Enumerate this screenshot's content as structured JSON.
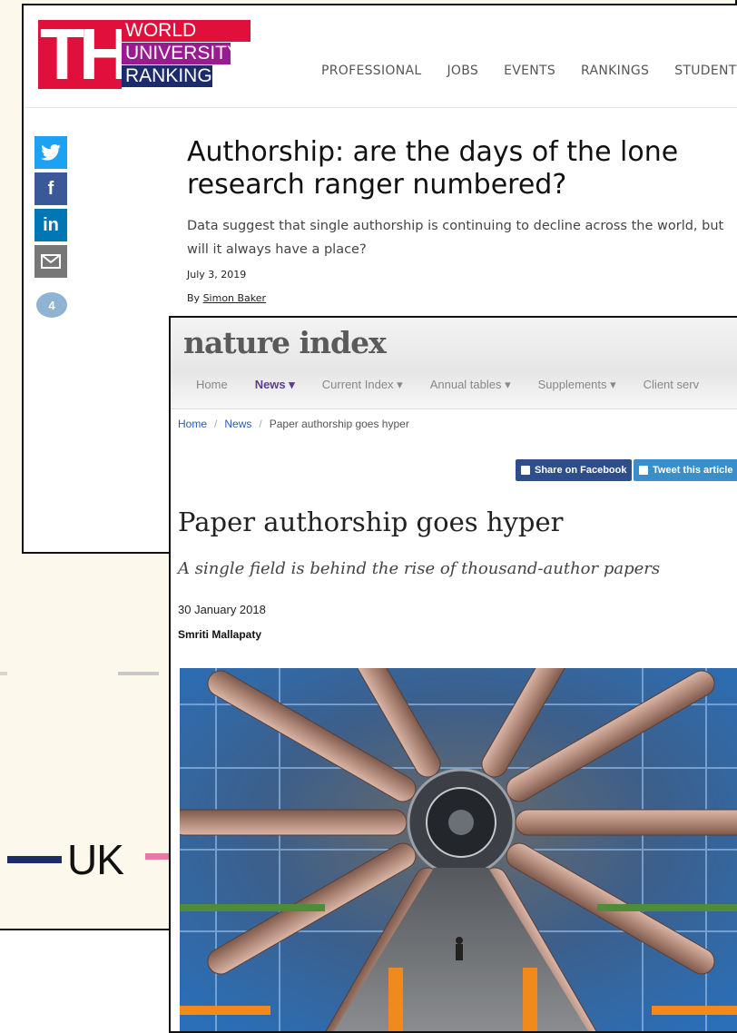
{
  "background_chart": {
    "legend_label": "UK",
    "colors": {
      "uk_line": "#1d2a6b",
      "other_line": "#e27aa6",
      "panel": "#fdf8ec"
    }
  },
  "the_article": {
    "logo": {
      "letters": "THE",
      "row1": "WORLD",
      "row2": "UNIVERSITY",
      "row3": "RANKINGS"
    },
    "nav": [
      "PROFESSIONAL",
      "JOBS",
      "EVENTS",
      "RANKINGS",
      "STUDENT"
    ],
    "share_icons": [
      "twitter-icon",
      "facebook-icon",
      "linkedin-icon",
      "email-icon"
    ],
    "share_labels": {
      "twitter": "t",
      "facebook": "f",
      "linkedin": "in",
      "email": "✉"
    },
    "comment_count": "4",
    "title": "Authorship: are the days of the lone research ranger numbered?",
    "standfirst": "Data suggest that single authorship is continuing to decline across the world, but will it always have a place?",
    "date": "July 3, 2019",
    "byline_prefix": "By",
    "author": "Simon Baker",
    "colors": {
      "brand_red": "#e10f3c",
      "brand_purple": "#9a1a8f",
      "brand_navy": "#1b2b6b"
    }
  },
  "nature_index": {
    "logo": "nature index",
    "nav": [
      {
        "label": "Home"
      },
      {
        "label": "News ▾"
      },
      {
        "label": "Current Index ▾"
      },
      {
        "label": "Annual tables ▾"
      },
      {
        "label": "Supplements ▾"
      },
      {
        "label": "Client serv"
      }
    ],
    "breadcrumb": {
      "home": "Home",
      "news": "News",
      "current": "Paper authorship goes hyper"
    },
    "share_facebook": "Share on Facebook",
    "share_twitter": "Tweet this article",
    "title": "Paper authorship goes hyper",
    "subtitle": "A single field is behind the rise of thousand-author papers",
    "date": "30 January 2018",
    "author": "Smriti Mallapaty",
    "colors": {
      "nav_active": "#5b3f8c",
      "facebook": "#2d4d8b",
      "twitter": "#3b8fc9"
    }
  }
}
